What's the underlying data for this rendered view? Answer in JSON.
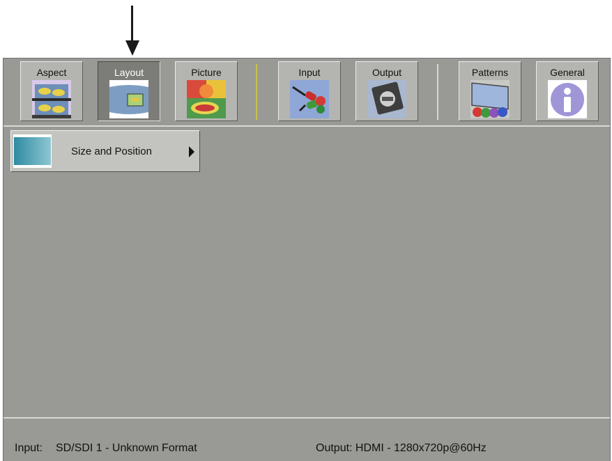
{
  "toolbar": {
    "tabs": [
      {
        "label": "Aspect",
        "icon": "aspect-icon"
      },
      {
        "label": "Layout",
        "icon": "layout-icon",
        "active": true
      },
      {
        "label": "Picture",
        "icon": "picture-icon"
      },
      {
        "label": "Input",
        "icon": "input-cable-icon"
      },
      {
        "label": "Output",
        "icon": "output-chip-icon"
      },
      {
        "label": "Patterns",
        "icon": "patterns-monitor-icon"
      },
      {
        "label": "General",
        "icon": "info-icon"
      }
    ]
  },
  "menu": {
    "items": [
      {
        "label": "Size and Position",
        "icon": "size-position-thumbnail-icon"
      }
    ]
  },
  "status": {
    "input_label": "Input:",
    "input_value": "SD/SDI 1 - Unknown Format",
    "output_text": "Output: HDMI - 1280x720p@60Hz"
  },
  "colors": {
    "screen_bg": "#999a96",
    "tab_bg": "#b4b5b1",
    "active_tab_bg": "#7c7d79",
    "separator": "#c8c24a"
  }
}
